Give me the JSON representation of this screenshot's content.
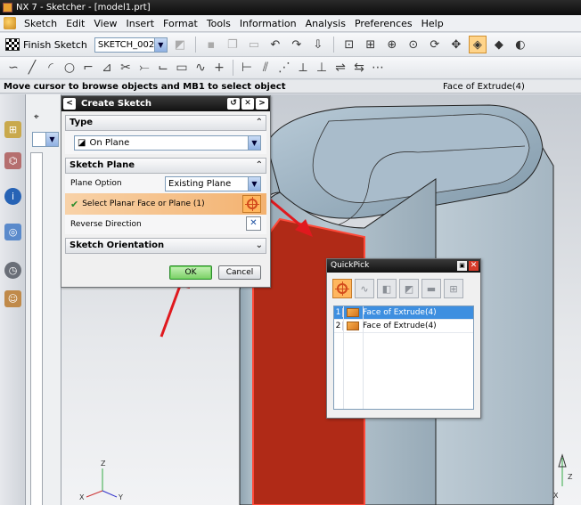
{
  "window": {
    "title": "NX 7 - Sketcher - [model1.prt]"
  },
  "menubar": {
    "items": [
      "Sketch",
      "Edit",
      "View",
      "Insert",
      "Format",
      "Tools",
      "Information",
      "Analysis",
      "Preferences",
      "Help"
    ]
  },
  "toolbar": {
    "finish_label": "Finish Sketch",
    "sketch_name": "SKETCH_002"
  },
  "status": {
    "prompt": "Move cursor to browse objects and MB1 to select object",
    "selection": "Face of Extrude(4)"
  },
  "create_sketch": {
    "title": "Create Sketch",
    "type_section": "Type",
    "type_value": "On Plane",
    "plane_section": "Sketch Plane",
    "plane_option_label": "Plane Option",
    "plane_option_value": "Existing Plane",
    "select_face_label": "Select Planar Face or Plane (1)",
    "reverse_label": "Reverse Direction",
    "orientation_section": "Sketch Orientation",
    "ok_label": "OK",
    "cancel_label": "Cancel"
  },
  "quickpick": {
    "title": "QuickPick",
    "items": [
      {
        "num": "1",
        "label": "Face of Extrude(4)"
      },
      {
        "num": "2",
        "label": "Face of Extrude(4)"
      }
    ]
  },
  "triad": {
    "x": "X",
    "y": "Y",
    "z": "Z"
  },
  "colors": {
    "accent_red": "#e0191e",
    "selected_face": "#b02a17",
    "selection_blue": "#3e8fe0",
    "ok_green": "#7cd067"
  }
}
